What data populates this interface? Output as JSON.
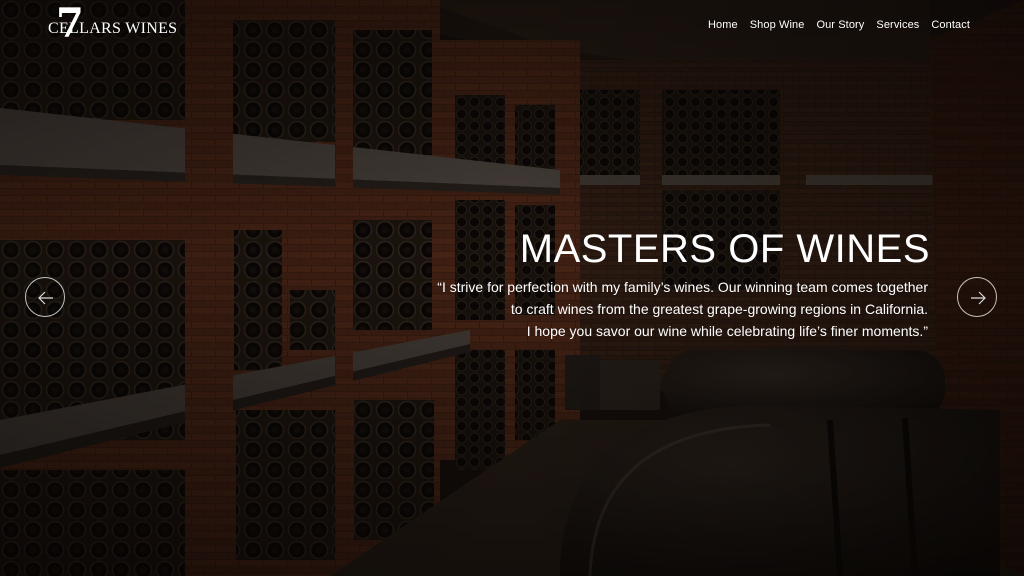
{
  "brand": {
    "logo_number": "7",
    "logo_text": "CELLARS WINES"
  },
  "nav": {
    "items": [
      "Home",
      "Shop Wine",
      "Our Story",
      "Services",
      "Contact"
    ]
  },
  "hero": {
    "headline": "MASTERS OF WINES",
    "quote_lines": [
      "“I strive for perfection with my family’s wines. Our winning team comes together",
      "to craft wines from the greatest grape-growing regions in California.",
      "I hope you savor our wine while celebrating life’s finer moments.”"
    ]
  },
  "slider": {
    "prev_icon": "arrow-left-icon",
    "next_icon": "arrow-right-icon"
  },
  "colors": {
    "text": "#ffffff",
    "overlay": "#120c08",
    "brick": "#6a3520",
    "bottle": "#1c1712",
    "barrel": "#3a3028"
  }
}
